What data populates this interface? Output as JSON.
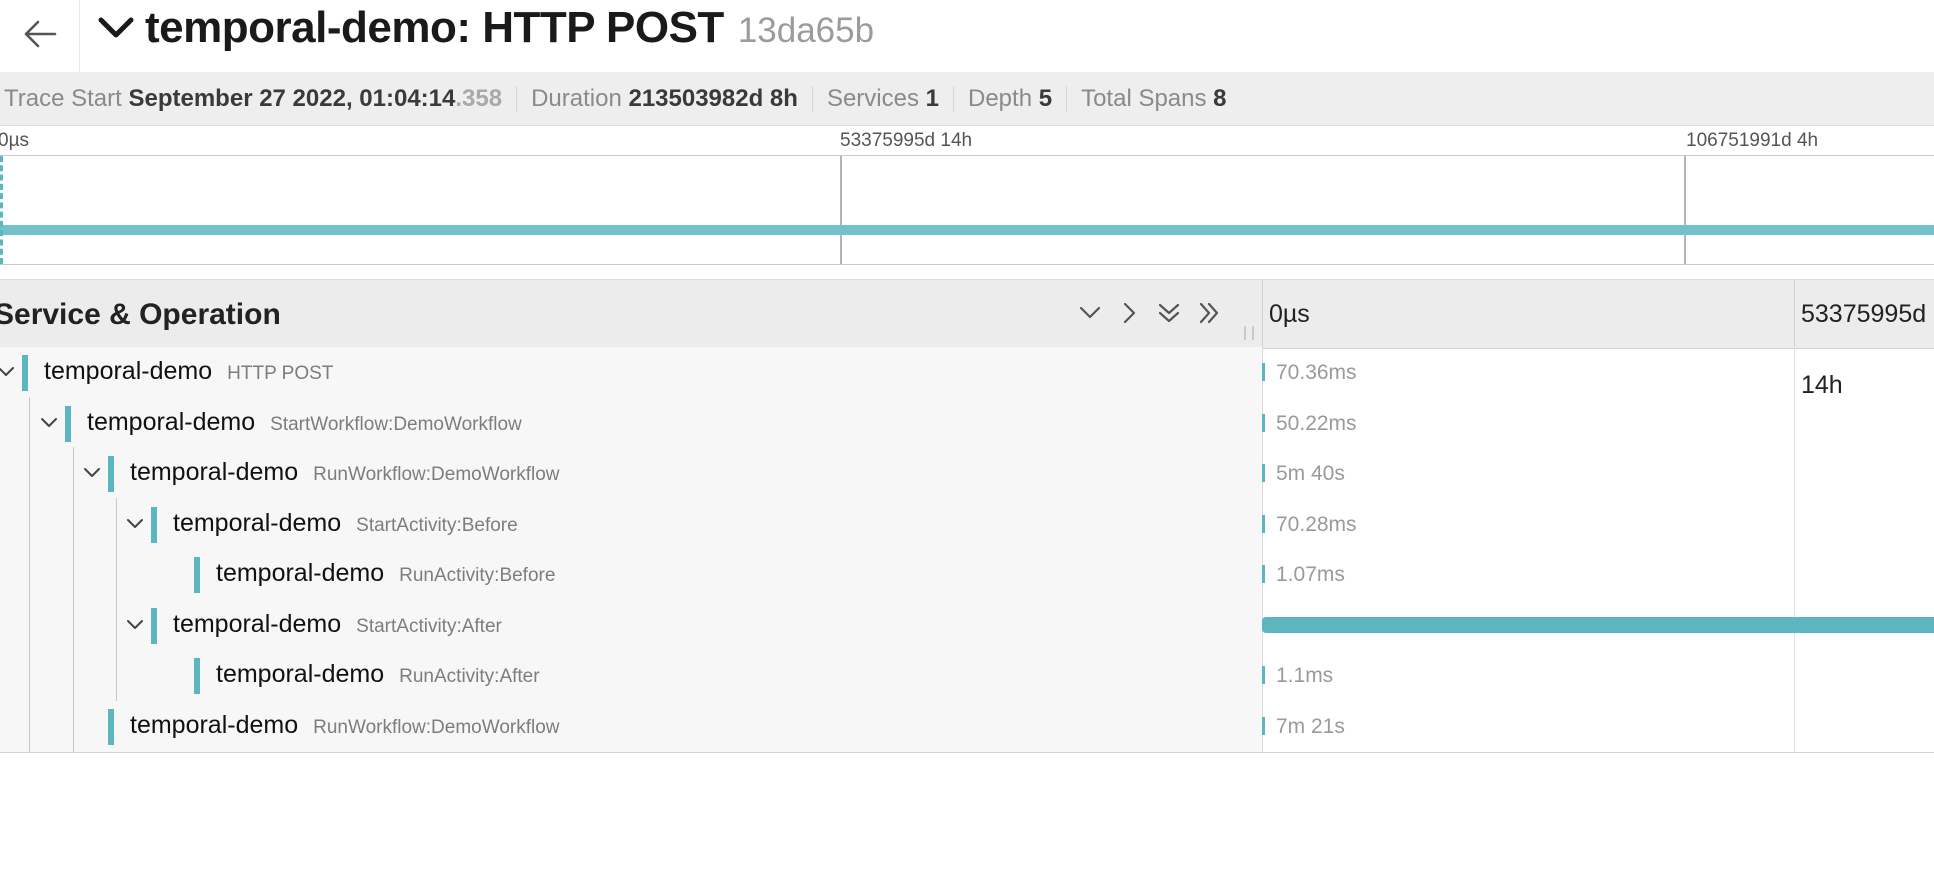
{
  "header": {
    "back_icon": "arrow-left-icon",
    "collapse_icon": "chevron-down-icon",
    "title": "temporal-demo: HTTP POST",
    "trace_id": "13da65b"
  },
  "summary": {
    "trace_start_label": "Trace Start",
    "trace_start_value": "September 27 2022, 01:04:14",
    "trace_start_ms": ".358",
    "duration_label": "Duration",
    "duration_value": "213503982d 8h",
    "services_label": "Services",
    "services_value": "1",
    "depth_label": "Depth",
    "depth_value": "5",
    "total_spans_label": "Total Spans",
    "total_spans_value": "8"
  },
  "minimap": {
    "ticks": [
      "0µs",
      "53375995d 14h",
      "106751991d 4h"
    ]
  },
  "table": {
    "column_title": "Service & Operation",
    "controls": [
      {
        "name": "collapse-one-icon"
      },
      {
        "name": "expand-one-icon"
      },
      {
        "name": "collapse-all-icon"
      },
      {
        "name": "expand-all-icon"
      }
    ],
    "timeline_ticks": [
      "0µs",
      "53375995d",
      "14h"
    ]
  },
  "spans": [
    {
      "service": "temporal-demo",
      "operation": "HTTP POST",
      "depth": 0,
      "has_children": true,
      "duration": "70.36ms"
    },
    {
      "service": "temporal-demo",
      "operation": "StartWorkflow:DemoWorkflow",
      "depth": 1,
      "has_children": true,
      "duration": "50.22ms"
    },
    {
      "service": "temporal-demo",
      "operation": "RunWorkflow:DemoWorkflow",
      "depth": 2,
      "has_children": true,
      "duration": "5m 40s"
    },
    {
      "service": "temporal-demo",
      "operation": "StartActivity:Before",
      "depth": 3,
      "has_children": true,
      "duration": "70.28ms"
    },
    {
      "service": "temporal-demo",
      "operation": "RunActivity:Before",
      "depth": 4,
      "has_children": false,
      "duration": "1.07ms"
    },
    {
      "service": "temporal-demo",
      "operation": "StartActivity:After",
      "depth": 3,
      "has_children": true,
      "duration": ""
    },
    {
      "service": "temporal-demo",
      "operation": "RunActivity:After",
      "depth": 4,
      "has_children": false,
      "duration": "1.1ms"
    },
    {
      "service": "temporal-demo",
      "operation": "RunWorkflow:DemoWorkflow",
      "depth": 2,
      "has_children": false,
      "duration": "7m 21s"
    }
  ],
  "colors": {
    "span_accent": "#5bb6bf",
    "minimap_span": "#72c2cb"
  }
}
